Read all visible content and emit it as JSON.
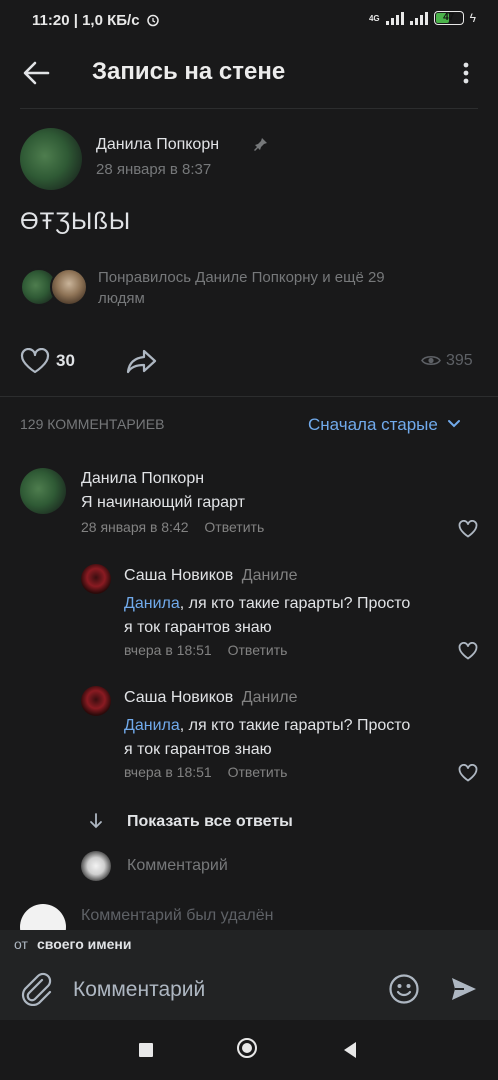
{
  "status_bar": {
    "time": "11:20",
    "speed": "1,0 КБ/с",
    "network": "4G",
    "battery": 47
  },
  "header": {
    "title": "Запись на стене"
  },
  "post": {
    "author": "Данила Попкорн",
    "date": "28 января в 8:37",
    "text": "ӨŦƷЫßЫ",
    "likes_text": "Понравилось Даниле Попкорну и ещё 29",
    "likes_text_2": "людям",
    "like_count": "30",
    "views": "395"
  },
  "comments_section": {
    "count_label": "129 КОММЕНТАРИЕВ",
    "sort_label": "Сначала старые"
  },
  "comments": [
    {
      "author": "Данила Попкорн",
      "text": "Я начинающий гарарт",
      "date": "28 января в 8:42",
      "reply": "Ответить"
    }
  ],
  "replies": [
    {
      "author": "Саша Новиков",
      "to": "Даниле",
      "mention": "Данила",
      "text_1": ", ля кто такие гарарты? Просто",
      "text_2": "я ток гарантов знаю",
      "date": "вчера в 18:51",
      "reply": "Ответить"
    },
    {
      "author": "Саша Новиков",
      "to": "Даниле",
      "mention": "Данила",
      "text_1": ", ля кто такие гарарты? Просто",
      "text_2": "я ток гарантов знаю",
      "date": "вчера в 18:51",
      "reply": "Ответить"
    }
  ],
  "show_all_replies": "Показать все ответы",
  "reply_input_placeholder": "Комментарий",
  "deleted_comment": "Комментарий был удалён",
  "as_author": {
    "prefix": "от",
    "label": "своего имени"
  },
  "composer": {
    "placeholder": "Комментарий"
  },
  "colors": {
    "accent": "#71aaeb",
    "background": "#19191a",
    "battery": "#4bb34b"
  },
  "icons": [
    "back-arrow-icon",
    "more-vertical-icon",
    "pin-icon",
    "heart-icon",
    "share-icon",
    "eye-icon",
    "chevron-down-icon",
    "arrow-down-icon",
    "attach-icon",
    "smile-icon",
    "send-icon",
    "nav-square-icon",
    "nav-circle-icon",
    "nav-back-icon"
  ]
}
